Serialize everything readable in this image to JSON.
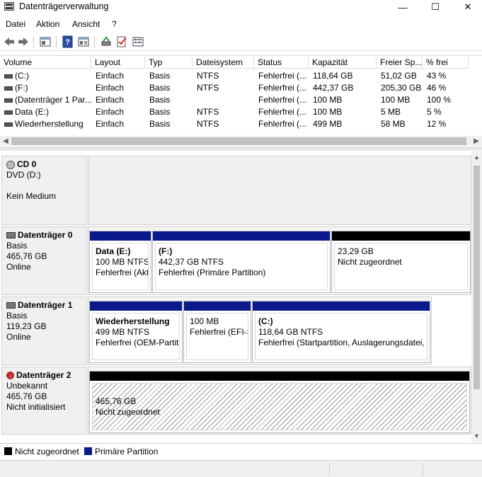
{
  "window": {
    "title": "Datenträgerverwaltung",
    "controls": {
      "minimize": "—",
      "maximize": "☐",
      "close": "✕"
    }
  },
  "menu": [
    "Datei",
    "Aktion",
    "Ansicht",
    "?"
  ],
  "toolbar": {
    "icons": [
      "back-icon",
      "forward-icon",
      "properties-icon",
      "help-icon",
      "view-icon",
      "connect-icon",
      "check-icon",
      "settings-icon"
    ]
  },
  "volume_list": {
    "columns": [
      "Volume",
      "Layout",
      "Typ",
      "Dateisystem",
      "Status",
      "Kapazität",
      "Freier Sp...",
      "% frei"
    ],
    "rows": [
      [
        "(C:)",
        "Einfach",
        "Basis",
        "NTFS",
        "Fehlerfrei (...",
        "118,64 GB",
        "51,02 GB",
        "43 %"
      ],
      [
        "(F:)",
        "Einfach",
        "Basis",
        "NTFS",
        "Fehlerfrei (...",
        "442,37 GB",
        "205,30 GB",
        "46 %"
      ],
      [
        "(Datenträger 1 Par...",
        "Einfach",
        "Basis",
        "",
        "Fehlerfrei (...",
        "100 MB",
        "100 MB",
        "100 %"
      ],
      [
        "Data (E:)",
        "Einfach",
        "Basis",
        "NTFS",
        "Fehlerfrei (...",
        "100 MB",
        "5 MB",
        "5 %"
      ],
      [
        "Wiederherstellung",
        "Einfach",
        "Basis",
        "NTFS",
        "Fehlerfrei (...",
        "499 MB",
        "58 MB",
        "12 %"
      ]
    ]
  },
  "disks": {
    "cd0": {
      "name": "CD 0",
      "type": "DVD (D:)",
      "status": "Kein Medium"
    },
    "disk0": {
      "name": "Datenträger 0",
      "type": "Basis",
      "size": "465,76 GB",
      "status": "Online",
      "partitions": [
        {
          "name": "Data  (E:)",
          "size": "100 MB NTFS",
          "status": "Fehlerfrei (Akt"
        },
        {
          "name": "(F:)",
          "size": "442,37 GB NTFS",
          "status": "Fehlerfrei (Primäre Partition)"
        },
        {
          "name": "",
          "size": "23,29 GB",
          "status": "Nicht zugeordnet"
        }
      ]
    },
    "disk1": {
      "name": "Datenträger 1",
      "type": "Basis",
      "size": "119,23 GB",
      "status": "Online",
      "partitions": [
        {
          "name": "Wiederherstellung",
          "size": "499 MB NTFS",
          "status": "Fehlerfrei (OEM-Partiti"
        },
        {
          "name": "",
          "size": "100 MB",
          "status": "Fehlerfrei (EFI-S"
        },
        {
          "name": "(C:)",
          "size": "118,64 GB NTFS",
          "status": "Fehlerfrei (Startpartition, Auslagerungsdatei, ."
        }
      ]
    },
    "disk2": {
      "name": "Datenträger 2",
      "type": "Unbekannt",
      "size": "465,76 GB",
      "status": "Nicht initialisiert",
      "partitions": [
        {
          "size": "465,76 GB",
          "status": "Nicht zugeordnet"
        }
      ]
    }
  },
  "legend": {
    "unallocated": "Nicht zugeordnet",
    "primary": "Primäre Partition"
  },
  "colors": {
    "primary": "#0a1a8c",
    "unallocated": "#000000"
  }
}
